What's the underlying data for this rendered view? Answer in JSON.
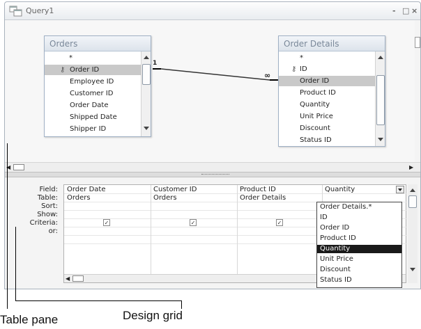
{
  "window": {
    "title": "Query1",
    "controls": [
      "-",
      "□",
      "×"
    ]
  },
  "tables": {
    "orders": {
      "name": "Orders",
      "fields": [
        "*",
        "Order ID",
        "Employee ID",
        "Customer ID",
        "Order Date",
        "Shipped Date",
        "Shipper ID"
      ],
      "selected": "Order ID"
    },
    "order_details": {
      "name": "Order Details",
      "fields": [
        "*",
        "ID",
        "Order ID",
        "Product ID",
        "Quantity",
        "Unit Price",
        "Discount",
        "Status ID"
      ],
      "selected": "Order ID"
    },
    "relationship": {
      "one_side": "1",
      "many_side": "∞"
    }
  },
  "design_grid": {
    "row_labels": [
      "Field:",
      "Table:",
      "Sort:",
      "Show:",
      "Criteria:",
      "or:"
    ],
    "columns": [
      {
        "field": "Order Date",
        "table": "Orders",
        "show": true
      },
      {
        "field": "Customer ID",
        "table": "Orders",
        "show": true
      },
      {
        "field": "Product ID",
        "table": "Order Details",
        "show": true
      },
      {
        "field": "Quantity",
        "table": "",
        "show": false
      }
    ],
    "dropdown_options": [
      "Order Details.*",
      "ID",
      "Order ID",
      "Product ID",
      "Quantity",
      "Unit Price",
      "Discount",
      "Status ID"
    ],
    "dropdown_selected": "Quantity"
  },
  "annotations": {
    "table_pane": "Table pane",
    "design_grid": "Design grid"
  },
  "icons": {
    "window": "query-window-icon",
    "key": "key-icon",
    "scroll_left": "scroll-left-icon",
    "scroll_right": "scroll-right-icon",
    "dropdown": "dropdown-arrow-icon"
  }
}
